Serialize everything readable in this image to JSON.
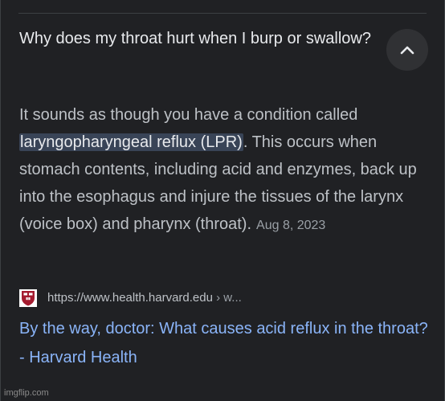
{
  "question": {
    "text": "Why does my throat hurt when I burp or swallow?"
  },
  "collapse_button": {
    "icon": "chevron-up-icon"
  },
  "answer": {
    "before": "It sounds as though you have a condition called ",
    "highlight": "laryngopharyngeal reflux (LPR)",
    "after": ". This occurs when stomach contents, including acid and enzymes, back up into the esophagus and injure the tissues of the larynx (voice box) and pharynx (throat).",
    "date": "Aug 8, 2023"
  },
  "source": {
    "favicon": "harvard-shield-icon",
    "url": "https://www.health.harvard.edu",
    "crumb": " › w..."
  },
  "result": {
    "title": "By the way, doctor: What causes acid reflux in the throat? - Harvard Health"
  },
  "watermark": "imgflip.com",
  "colors": {
    "background": "#202124",
    "link": "#8ab4f8",
    "highlight": "#394457",
    "harvard_crimson": "#a51c30"
  }
}
